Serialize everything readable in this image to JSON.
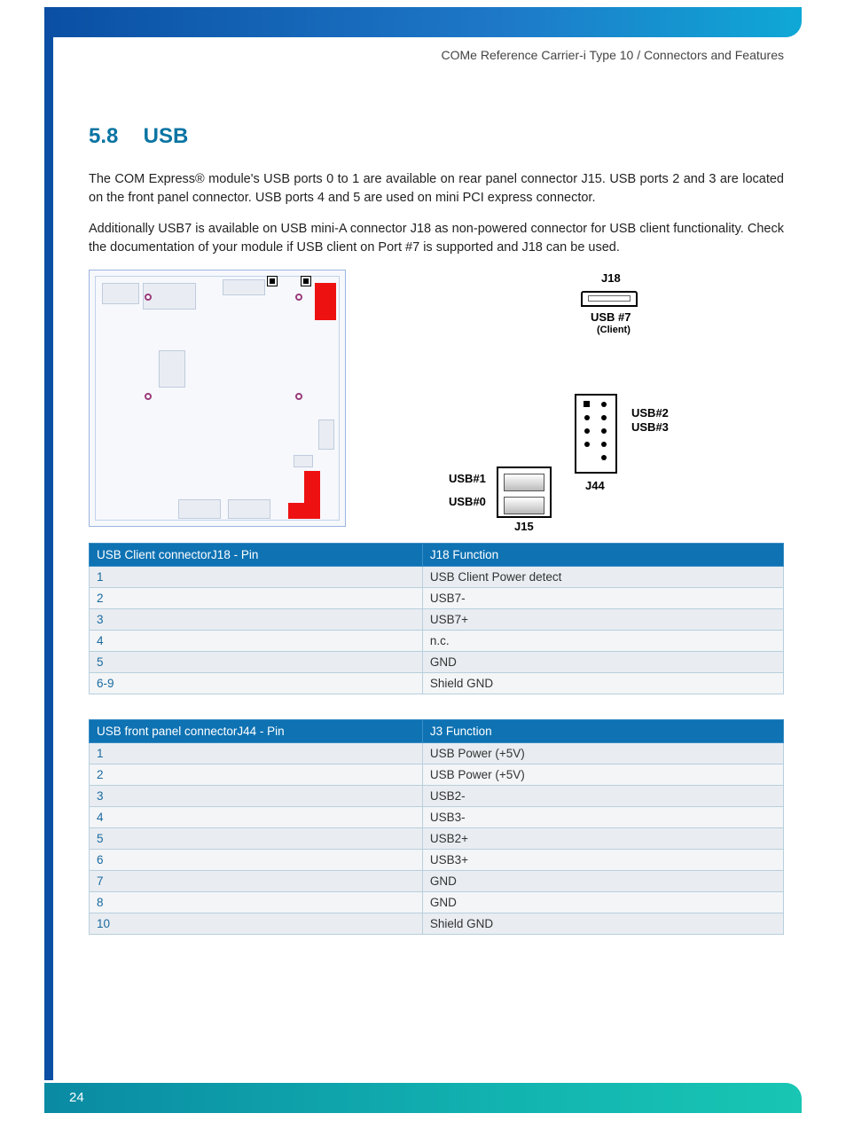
{
  "header_path": "COMe Reference Carrier-i Type 10 / Connectors and Features",
  "section": {
    "num": "5.8",
    "title": "USB"
  },
  "para1": "The COM Express® module's USB ports 0 to 1 are available on rear panel connector J15. USB ports 2 and 3 are located on the front panel connector. USB ports 4 and 5 are used on mini PCI express connector.",
  "para2": "Additionally USB7 is available on USB mini-A connector J18 as non-powered connector for USB client functionality. Check the documentation of your module if USB client on Port #7 is supported and J18 can be used.",
  "ports": {
    "j18": "J18",
    "usb7": "USB #7",
    "client": "(Client)",
    "usb2": "USB#2",
    "usb3": "USB#3",
    "usb1": "USB#1",
    "usb0": "USB#0",
    "j44": "J44",
    "j15": "J15"
  },
  "table1": {
    "h1": "USB Client connectorJ18 - Pin",
    "h2": "J18 Function",
    "rows": [
      {
        "pin": "1",
        "fn": "USB Client Power detect"
      },
      {
        "pin": "2",
        "fn": "USB7-"
      },
      {
        "pin": "3",
        "fn": "USB7+"
      },
      {
        "pin": "4",
        "fn": "n.c."
      },
      {
        "pin": "5",
        "fn": "GND"
      },
      {
        "pin": "6-9",
        "fn": "Shield GND"
      }
    ]
  },
  "table2": {
    "h1": "USB front panel connectorJ44 - Pin",
    "h2": "J3 Function",
    "rows": [
      {
        "pin": "1",
        "fn": "USB Power (+5V)"
      },
      {
        "pin": "2",
        "fn": "USB Power (+5V)"
      },
      {
        "pin": "3",
        "fn": "USB2-"
      },
      {
        "pin": "4",
        "fn": "USB3-"
      },
      {
        "pin": "5",
        "fn": "USB2+"
      },
      {
        "pin": "6",
        "fn": "USB3+"
      },
      {
        "pin": "7",
        "fn": "GND"
      },
      {
        "pin": "8",
        "fn": "GND"
      },
      {
        "pin": "10",
        "fn": "Shield GND"
      }
    ]
  },
  "page_number": "24"
}
